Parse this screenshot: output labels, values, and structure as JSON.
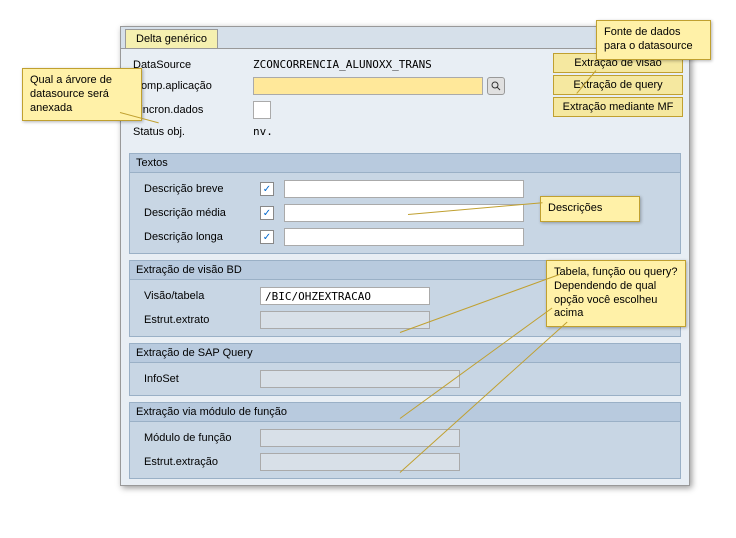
{
  "tab": {
    "label": "Delta genérico"
  },
  "top_form": {
    "datasource_label": "DataSource",
    "datasource_value": "ZCONCORRENCIA_ALUNOXX_TRANS",
    "comp_aplicacao_label": "Comp.aplicação",
    "comp_aplicacao_value": "",
    "sincron_label": "Sincron.dados",
    "sincron_value": "",
    "status_label": "Status obj.",
    "status_value": "nv."
  },
  "buttons": {
    "ext_visao": "Extração de visão",
    "ext_query": "Extração de query",
    "ext_mf": "Extração mediante MF"
  },
  "textos": {
    "title": "Textos",
    "desc_breve_label": "Descrição breve",
    "desc_media_label": "Descrição média",
    "desc_longa_label": "Descrição longa",
    "check": "✓"
  },
  "ext_bd": {
    "title": "Extração de visão BD",
    "visao_tabela_label": "Visão/tabela",
    "visao_tabela_value": "/BIC/OHZEXTRACAO",
    "estrut_label": "Estrut.extrato",
    "estrut_value": ""
  },
  "ext_sap_query": {
    "title": "Extração de SAP Query",
    "infoset_label": "InfoSet",
    "infoset_value": ""
  },
  "ext_modulo": {
    "title": "Extração via módulo de função",
    "modulo_label": "Módulo de função",
    "modulo_value": "",
    "estrut_label": "Estrut.extração",
    "estrut_value": ""
  },
  "callouts": {
    "c1": "Qual a árvore de datasource será anexada",
    "c2": "Fonte de dados para o datasource",
    "c3": "Descrições",
    "c4": "Tabela, função ou query? Dependendo de qual opção você escolheu acima"
  }
}
